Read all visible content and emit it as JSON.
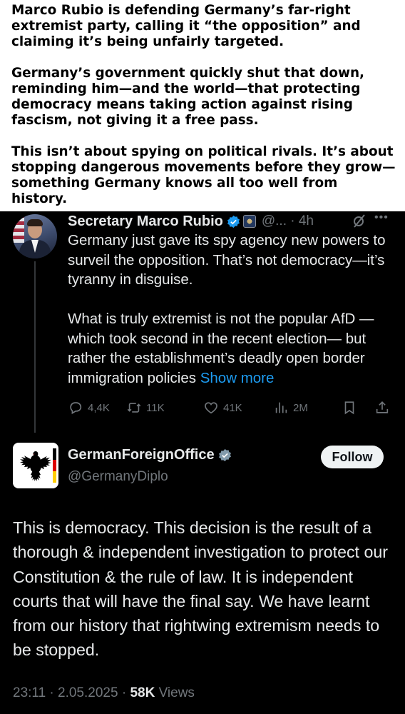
{
  "caption": {
    "p1": "Marco Rubio is defending Germany’s far-right extremist party, calling it “the opposition” and claiming it’s being unfairly targeted.",
    "p2": "Germany’s government quickly shut that down, reminding him—and the world—that protecting democracy means taking action against rising fascism, not giving it a free pass.",
    "p3": "This isn’t about spying on political rivals. It’s about stopping dangerous movements before they grow—something Germany knows all too well from history."
  },
  "tweet1": {
    "name": "Secretary Marco Rubio",
    "handle_time": "@... · 4h",
    "para1": "Germany just gave its spy agency new powers to surveil the opposition.  That’s not democracy—it’s tyranny in disguise.",
    "para2": "What is truly extremist is not the popular AfD —which took second in the recent election— but rather the establishment’s deadly open border immigration policies",
    "show_more": "Show more",
    "stats": {
      "replies": "4,4K",
      "reposts": "11K",
      "likes": "41K",
      "views": "2M"
    }
  },
  "tweet2": {
    "name": "GermanForeignOffice",
    "handle": "@GermanyDiplo",
    "follow_label": "Follow",
    "text": "This is democracy. This decision is the result of a thorough & independent investigation to protect our Constitution & the rule of law. It is independent courts that will have the final say. We have learnt from our history that rightwing extremism needs to be stopped.",
    "time": "23:11 · 2.05.2025 · ",
    "views_count": "58K",
    "views_label": " Views"
  },
  "colors": {
    "background": "#000000",
    "text": "#e7e9ea",
    "muted": "#71767b",
    "link": "#1d9bf0",
    "verified": "#1d9bf0"
  },
  "icons": [
    "reply-icon",
    "repost-icon",
    "like-icon",
    "views-icon",
    "bookmark-icon",
    "share-icon",
    "verified-icon",
    "grok-icon",
    "more-icon"
  ]
}
